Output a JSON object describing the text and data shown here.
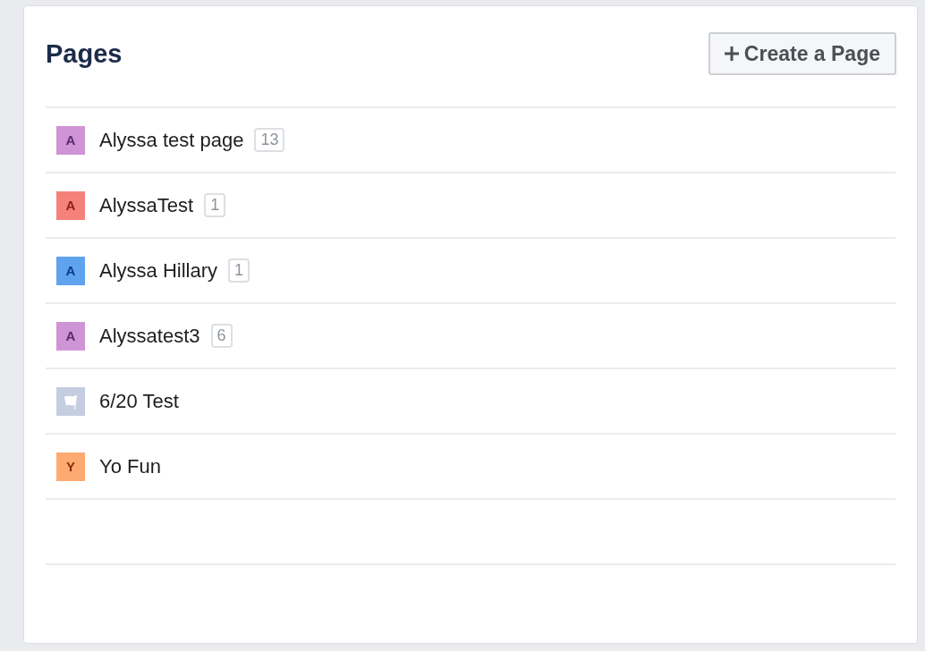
{
  "title": "Pages",
  "create_button": {
    "label": "Create a Page"
  },
  "pages": [
    {
      "name": "Alyssa test page",
      "count": "13",
      "avatar": {
        "kind": "letter",
        "letter": "A",
        "color": "#cf94d6"
      }
    },
    {
      "name": "AlyssaTest",
      "count": "1",
      "avatar": {
        "kind": "letter",
        "letter": "A",
        "color": "#f5827a"
      }
    },
    {
      "name": "Alyssa Hillary",
      "count": "1",
      "avatar": {
        "kind": "letter",
        "letter": "A",
        "color": "#5fa3ef"
      }
    },
    {
      "name": "Alyssatest3",
      "count": "6",
      "avatar": {
        "kind": "letter",
        "letter": "A",
        "color": "#cf94d6"
      }
    },
    {
      "name": "6/20 Test",
      "avatar": {
        "kind": "flag",
        "color": "#c5cde0"
      }
    },
    {
      "name": "Yo Fun",
      "avatar": {
        "kind": "letter",
        "letter": "Y",
        "color": "#fdaa72"
      }
    }
  ]
}
